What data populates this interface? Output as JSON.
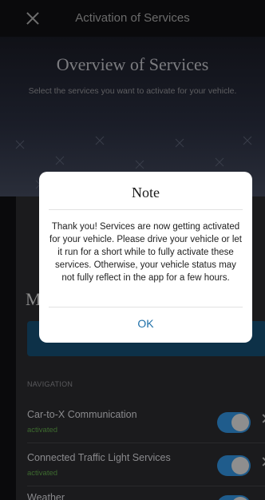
{
  "topbar": {
    "title": "Activation of Services",
    "close_icon": "close-icon"
  },
  "hero": {
    "title": "Overview of Services",
    "subtitle": "Select the services you want to activate for your vehicle."
  },
  "behind": {
    "heading_fragment": "M"
  },
  "section": {
    "label": "NAVIGATION"
  },
  "services": [
    {
      "name": "Car-to-X Communication",
      "status": "activated"
    },
    {
      "name": "Connected Traffic Light Services",
      "status": "activated"
    },
    {
      "name": "Weather"
    }
  ],
  "modal": {
    "title": "Note",
    "body": "Thank you! Services are now getting activated for your vehicle. Please drive your vehicle or let it run for a short while to fully activate these services. Otherwise, your vehicle status may not fully reflect in the app for a few hours.",
    "ok_label": "OK"
  },
  "colors": {
    "accent": "#1e6fa8",
    "toggle_on": "#1f5c8c",
    "status_green": "#3d6a2f"
  }
}
